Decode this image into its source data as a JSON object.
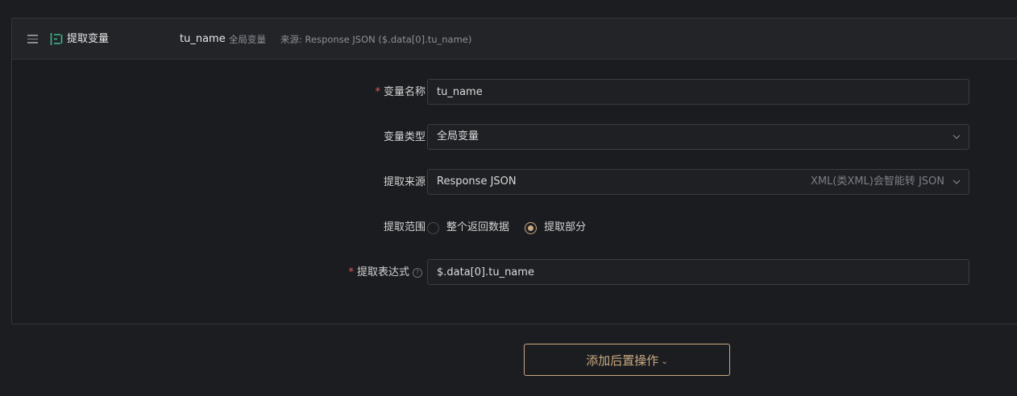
{
  "header": {
    "title": "提取变量",
    "var_name": "tu_name",
    "var_type": "全局变量",
    "source": "来源: Response JSON ($.data[0].tu_name)"
  },
  "form": {
    "var_name": {
      "label": "变量名称",
      "required_mark": "*",
      "value": "tu_name"
    },
    "var_type": {
      "label": "变量类型",
      "value": "全局变量"
    },
    "extract_source": {
      "label": "提取来源",
      "value": "Response JSON",
      "hint": "XML(类XML)会智能转 JSON"
    },
    "extract_range": {
      "label": "提取范围",
      "options": [
        {
          "label": "整个返回数据",
          "checked": false
        },
        {
          "label": "提取部分",
          "checked": true
        }
      ]
    },
    "expression": {
      "label": "提取表达式",
      "required_mark": "*",
      "help": "?",
      "value": "$.data[0].tu_name"
    }
  },
  "actions": {
    "add_post_label": "添加后置操作",
    "caret": "⌄"
  },
  "colors": {
    "accent": "#c9ab80",
    "icon_green": "#3fb58a",
    "required": "#e05a58"
  }
}
